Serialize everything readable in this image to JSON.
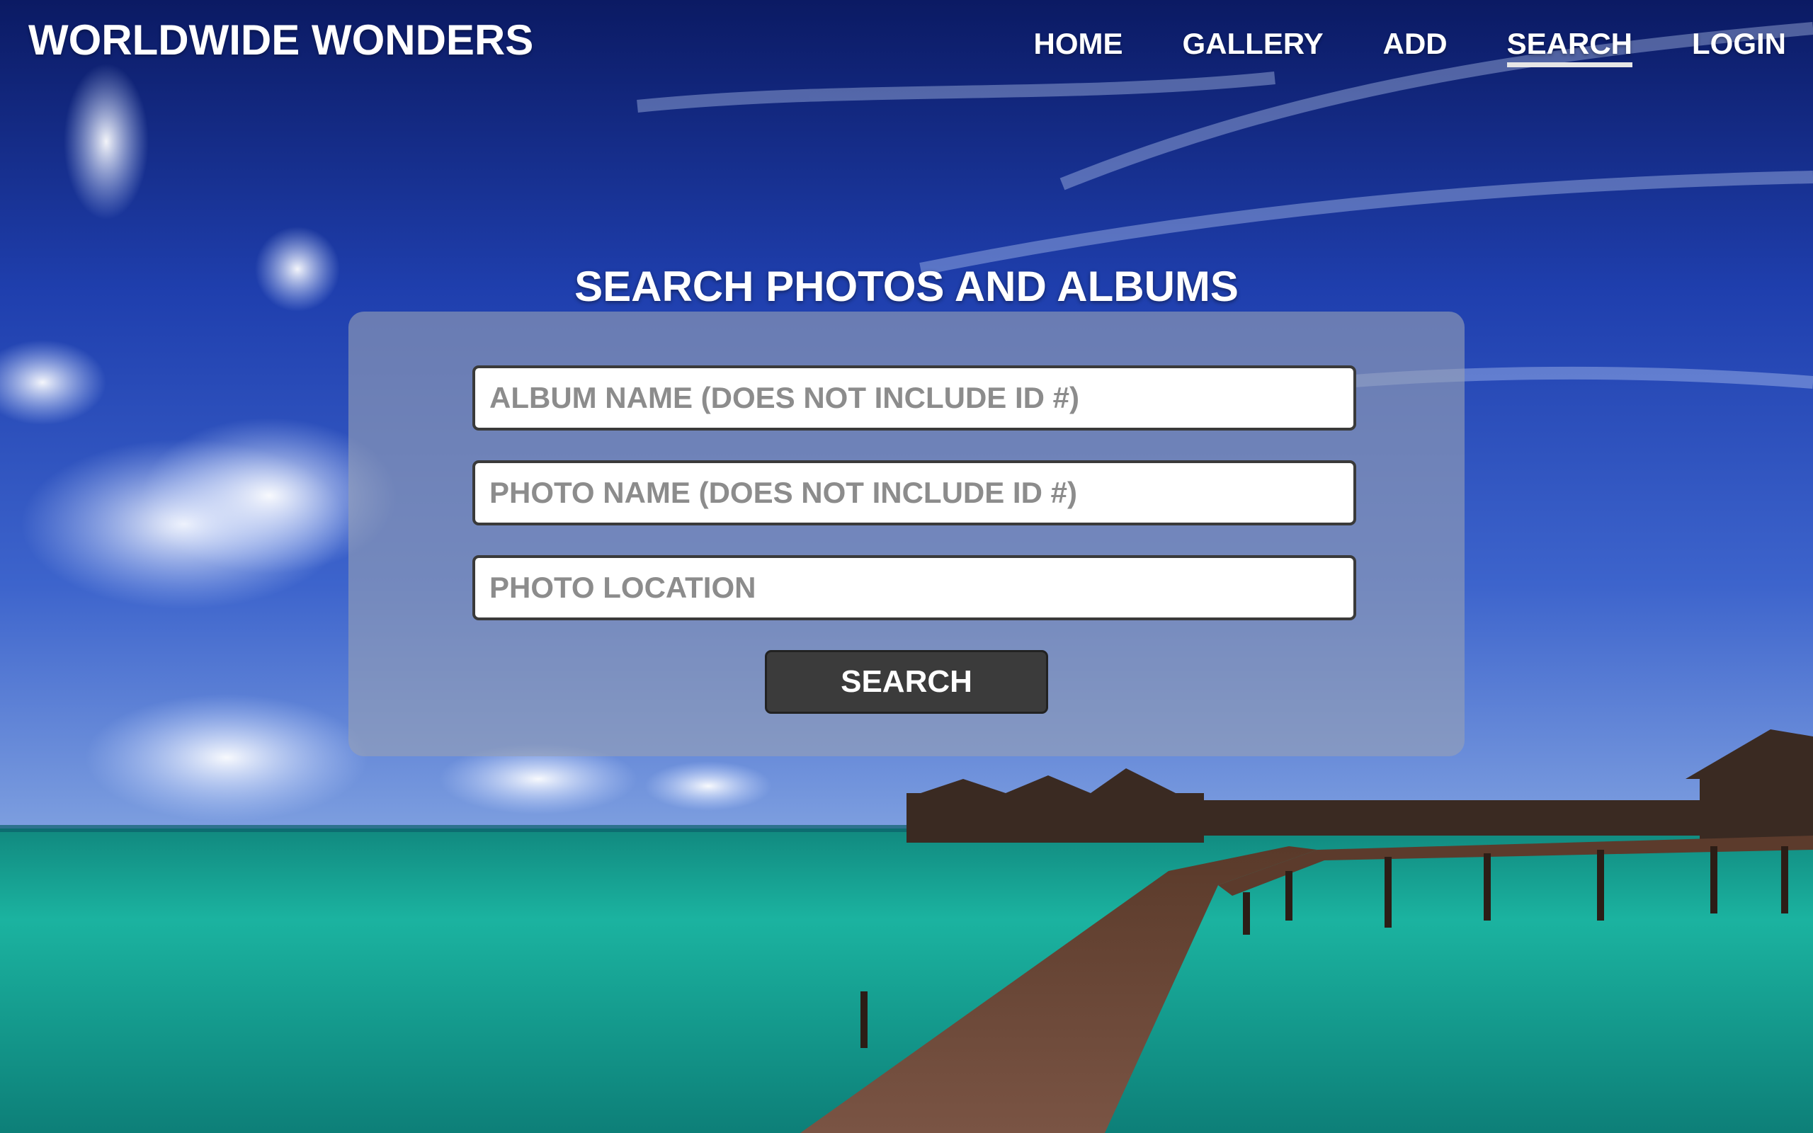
{
  "header": {
    "site_title": "WORLDWIDE WONDERS",
    "nav": [
      {
        "label": "HOME",
        "active": false
      },
      {
        "label": "GALLERY",
        "active": false
      },
      {
        "label": "ADD",
        "active": false
      },
      {
        "label": "SEARCH",
        "active": true
      },
      {
        "label": "LOGIN",
        "active": false
      }
    ]
  },
  "main": {
    "title": "SEARCH PHOTOS AND ALBUMS",
    "form": {
      "album_name": {
        "value": "",
        "placeholder": "ALBUM NAME (DOES NOT INCLUDE ID #)"
      },
      "photo_name": {
        "value": "",
        "placeholder": "PHOTO NAME (DOES NOT INCLUDE ID #)"
      },
      "photo_location": {
        "value": "",
        "placeholder": "PHOTO LOCATION"
      },
      "submit_label": "SEARCH"
    }
  },
  "colors": {
    "sky_deep": "#0a1e6e",
    "sky_mid": "#2a4fc0",
    "water_teal": "#1fb8a6",
    "panel": "#96a0b4",
    "button": "#3b3b3b",
    "text": "#ffffff"
  }
}
